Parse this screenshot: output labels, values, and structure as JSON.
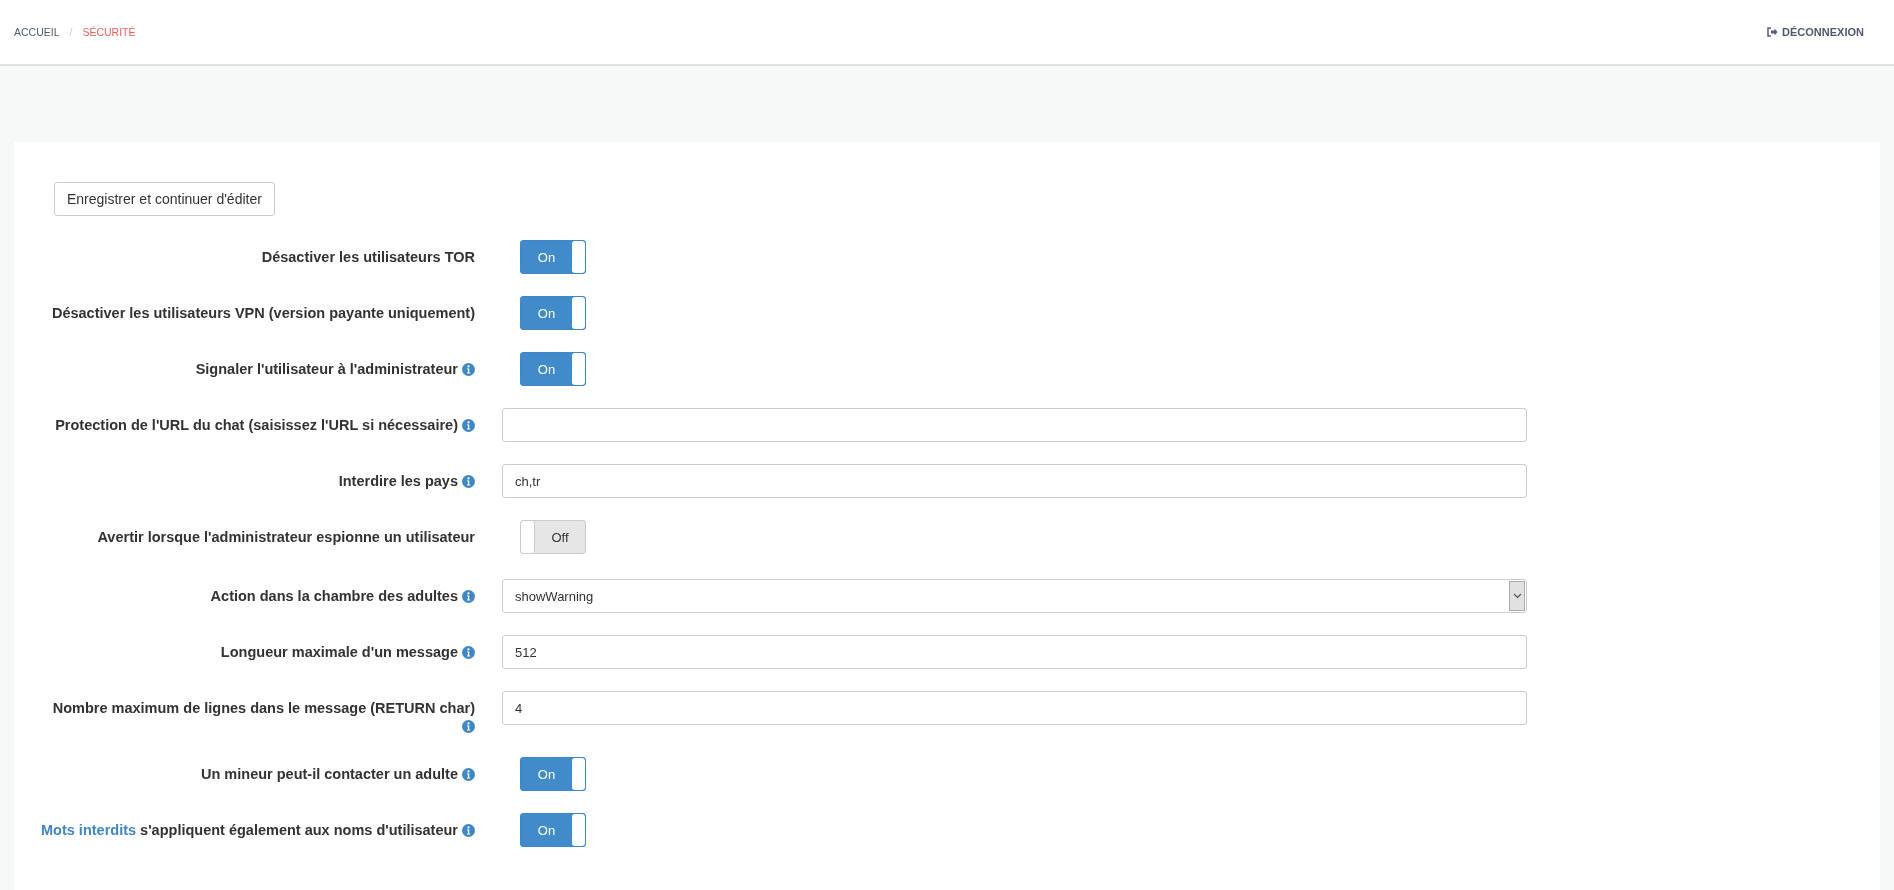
{
  "breadcrumb": [
    {
      "label": "ACCUEIL",
      "selected": false
    },
    {
      "label": "SÉCURITÉ",
      "selected": true
    }
  ],
  "breadcrumb_separator": "/",
  "logout": {
    "label": "DÉCONNEXION"
  },
  "save_button": {
    "label": "Enregistrer et continuer d'éditer"
  },
  "fields": [
    {
      "kind": "toggle",
      "label": "Désactiver les utilisateurs TOR",
      "info": false,
      "on": true,
      "text": "On"
    },
    {
      "kind": "toggle",
      "label": "Désactiver les utilisateurs VPN (version payante uniquement)",
      "info": false,
      "on": true,
      "text": "On"
    },
    {
      "kind": "toggle",
      "label": "Signaler l'utilisateur à l'administrateur",
      "info": true,
      "on": true,
      "text": "On"
    },
    {
      "kind": "text",
      "label": "Protection de l'URL du chat (saisissez l'URL si nécessaire)",
      "info": true
    },
    {
      "kind": "text",
      "label": "Interdire les pays",
      "info": true,
      "value": "ch,tr"
    },
    {
      "kind": "toggle",
      "label": "Avertir lorsque l'administrateur espionne un utilisateur",
      "info": false,
      "on": false,
      "text": "Off"
    },
    {
      "kind": "select",
      "label": "Action dans la chambre des adultes",
      "info": true,
      "value": "showWarning"
    },
    {
      "kind": "text",
      "label": "Longueur maximale d'un message",
      "info": true,
      "value": "512"
    },
    {
      "kind": "text",
      "label": "Nombre maximum de lignes dans le message (RETURN char)",
      "info": true,
      "value": "4"
    },
    {
      "kind": "toggle",
      "label": "Un mineur peut-il contacter un adulte",
      "info": true,
      "on": true,
      "text": "On"
    },
    {
      "kind": "toggle",
      "link": "Mots interdits",
      "label": "s'appliquent également aux noms d'utilisateur",
      "info": true,
      "on": true,
      "text": "On"
    }
  ]
}
